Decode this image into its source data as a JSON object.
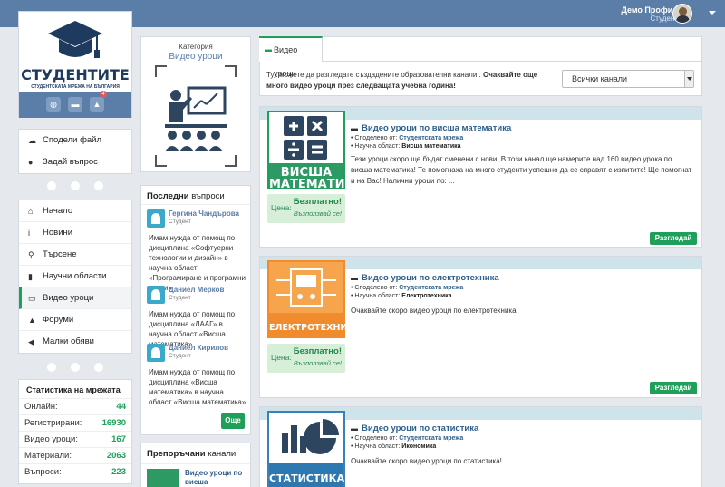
{
  "header": {
    "user_name": "Демо Профил",
    "user_role": "Студент"
  },
  "logo": {
    "title": "СТУДЕНТИТЕ",
    "subtitle": "СТУДЕНТСКАТА МРЕЖА НА БЪЛГАРИЯ",
    "notif_count": "4"
  },
  "actions": {
    "items": [
      {
        "label": "Сподели файл",
        "icon": "cloud-upload-icon"
      },
      {
        "label": "Задай въпрос",
        "icon": "chat-icon"
      }
    ]
  },
  "nav": {
    "items": [
      {
        "label": "Начало",
        "icon": "home-icon"
      },
      {
        "label": "Новини",
        "icon": "info-icon"
      },
      {
        "label": "Търсене",
        "icon": "search-icon"
      },
      {
        "label": "Научни области",
        "icon": "chart-icon"
      },
      {
        "label": "Видео уроци",
        "icon": "monitor-icon",
        "active": true
      },
      {
        "label": "Форуми",
        "icon": "graduation-cap-icon"
      },
      {
        "label": "Малки обяви",
        "icon": "megaphone-icon"
      }
    ]
  },
  "stats": {
    "title": "Статистика на мрежата",
    "rows": [
      {
        "label": "Онлайн:",
        "value": "44"
      },
      {
        "label": "Регистрирани:",
        "value": "16930"
      },
      {
        "label": "Видео уроци:",
        "value": "167"
      },
      {
        "label": "Материали:",
        "value": "2063"
      },
      {
        "label": "Въпроси:",
        "value": "223"
      }
    ]
  },
  "category": {
    "label": "Категория",
    "name": "Видео уроци"
  },
  "questions": {
    "title_bold": "Последни",
    "title_rest": " въпроси",
    "items": [
      {
        "name": "Гергина Чандърова",
        "role": "Студент",
        "text": "Имам нужда от помощ по дисциплина «Софтуерни технологии и дизайн» в научна област «Програмиране и програмни езици»"
      },
      {
        "name": "Даниел Мерков",
        "role": "Студент",
        "text": "Имам нужда от помощ по дисциплина «ЛААГ» в научна област «Висша математика»"
      },
      {
        "name": "Даниел Кирилов",
        "role": "Студент",
        "text": "Имам нужда от помощ по дисциплина «Висша математика» в научна област «Висша математика»"
      }
    ],
    "more_label": "Още"
  },
  "recommended": {
    "title_bold": "Препоръчани",
    "title_rest": " канали",
    "item": "Видео уроци по висша математика"
  },
  "tabs": {
    "active_label": "Видео уроци"
  },
  "intro": {
    "text": "Тук можете да разгледате създадените образователни канали . ",
    "bold": "Очаквайте още много видео уроци през следващата учебна година!"
  },
  "filter": {
    "selected": "Всички канали"
  },
  "channels": [
    {
      "title": "Видео уроци по висша математика",
      "shared_by_label": "• Споделено от: ",
      "shared_by": "Студентската мрежа",
      "area_label": "• Научна област: ",
      "area": "Висша математика",
      "description": "Тези уроци скоро ще бъдат сменени с нови! В този канал ще намерите над 160 видео урока по висша математика! Те помогнаха на много студенти успешно да се справят с изпитите! Ще помогнат и на Вас! Налични уроци по: ...",
      "image_label": "ВИСША МАТЕМАТИКА",
      "price_label": "Цена:",
      "price": "Безплатно!",
      "price_note": "Възползвай се!",
      "button": "Разгледай"
    },
    {
      "title": "Видео уроци по електротехника",
      "shared_by_label": "• Споделено от: ",
      "shared_by": "Студентската мрежа",
      "area_label": "• Научна област: ",
      "area": "Електротехника",
      "description": "Очаквайте скоро видео уроци по електротехника!",
      "image_label": "ЕЛЕКТРОТЕХНИКА",
      "price_label": "Цена:",
      "price": "Безплатно!",
      "price_note": "Възползвай се!",
      "button": "Разгледай"
    },
    {
      "title": "Видео уроци по статистика",
      "shared_by_label": "• Споделено от: ",
      "shared_by": "Студентската мрежа",
      "area_label": "• Научна област: ",
      "area": "Икономика",
      "description": "Очаквайте скоро видео уроци по статистика!",
      "image_label": "СТАТИСТИКА"
    }
  ],
  "colors": {
    "topbar": "#5a7ea8",
    "accent": "#1fa05a",
    "orange": "#f08c2e",
    "blue": "#2d78b0"
  }
}
